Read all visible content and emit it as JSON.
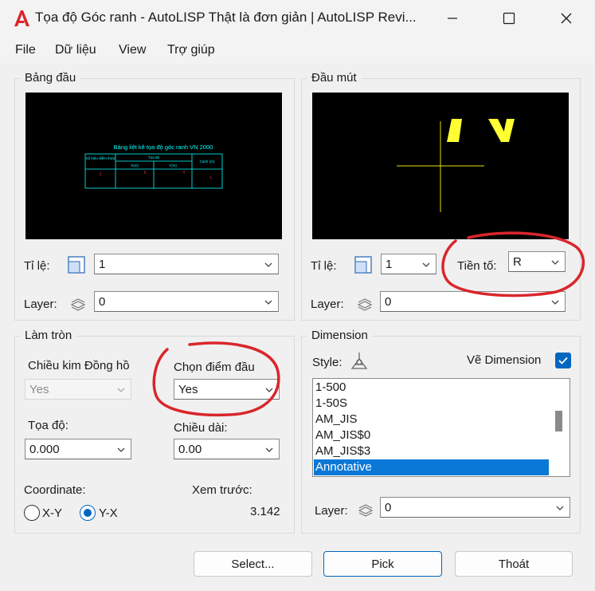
{
  "window": {
    "title": "Tọa độ Góc ranh - AutoLISP Thật là đơn giản | AutoLISP Revi...",
    "colors": {
      "accent": "#0067c0",
      "annotation_red": "#d9262c"
    }
  },
  "menu": [
    "File",
    "Dữ liệu",
    "View",
    "Trợ giúp"
  ],
  "bang_dau": {
    "label": "Bảng đầu",
    "preview_table": {
      "title": "Bảng liệt kê tọa độ góc ranh VN 2000",
      "col_so_hieu": "Số hiệu điểm thửa",
      "col_toa_do": "Tọa độ",
      "col_x": "X(m)",
      "col_y": "Y(m)",
      "col_canh": "Cạnh (m)",
      "row_1": "1",
      "row_x": "X",
      "row_y": "Y",
      "row_l": "L"
    },
    "ti_le_label": "Tỉ lệ:",
    "ti_le_value": "1",
    "layer_label": "Layer:",
    "layer_value": "0"
  },
  "dau_mut": {
    "label": "Đầu mút",
    "ti_le_label": "Tỉ lệ:",
    "ti_le_value": "1",
    "tien_to_label": "Tiền tố:",
    "tien_to_value": "R",
    "layer_label": "Layer:",
    "layer_value": "0"
  },
  "lam_tron": {
    "label": "Làm tròn",
    "chieu_kim_label": "Chiều kim Đồng hồ",
    "chieu_kim_value": "Yes",
    "chon_diem_label": "Chọn điểm đầu",
    "chon_diem_value": "Yes",
    "toa_do_label": "Tọa độ:",
    "toa_do_value": "0.000",
    "chieu_dai_label": "Chiều dài:",
    "chieu_dai_value": "0.00",
    "coordinate_label": "Coordinate:",
    "radio_xy": "X-Y",
    "radio_yx": "Y-X",
    "selected_radio": "Y-X",
    "xem_truoc_label": "Xem trước:",
    "xem_truoc_value": "3.142"
  },
  "dimension": {
    "label": "Dimension",
    "style_label": "Style:",
    "ve_dimension_label": "Vẽ Dimension",
    "ve_dimension_checked": true,
    "styles": [
      "1-500",
      "1-50S",
      "AM_JIS",
      "AM_JIS$0",
      "AM_JIS$3",
      "Annotative"
    ],
    "selected_style": "Annotative",
    "layer_label": "Layer:",
    "layer_value": "0"
  },
  "buttons": {
    "select": "Select...",
    "pick": "Pick",
    "thoat": "Thoát"
  }
}
